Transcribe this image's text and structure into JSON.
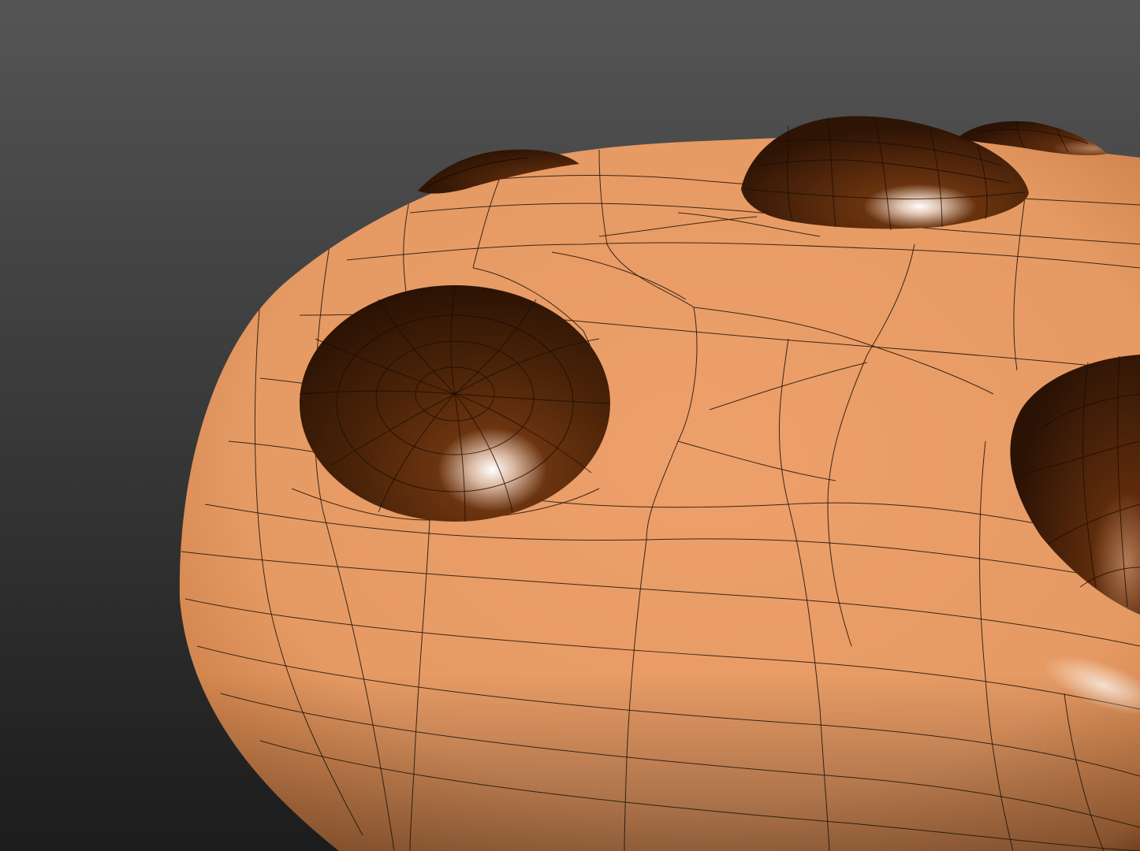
{
  "viewport": {
    "background_top": "#545454",
    "background_bottom": "#1e1e1e",
    "shading": "smooth-with-wireframe"
  },
  "model": {
    "object": "cookie",
    "dough_color": "#e8975f",
    "dough_shadow": "#9c5a2c",
    "chip_color": "#3f1e06",
    "chip_highlight": "#ffffff",
    "wire_color": "#1a1208",
    "chip_count_visible": 5
  }
}
